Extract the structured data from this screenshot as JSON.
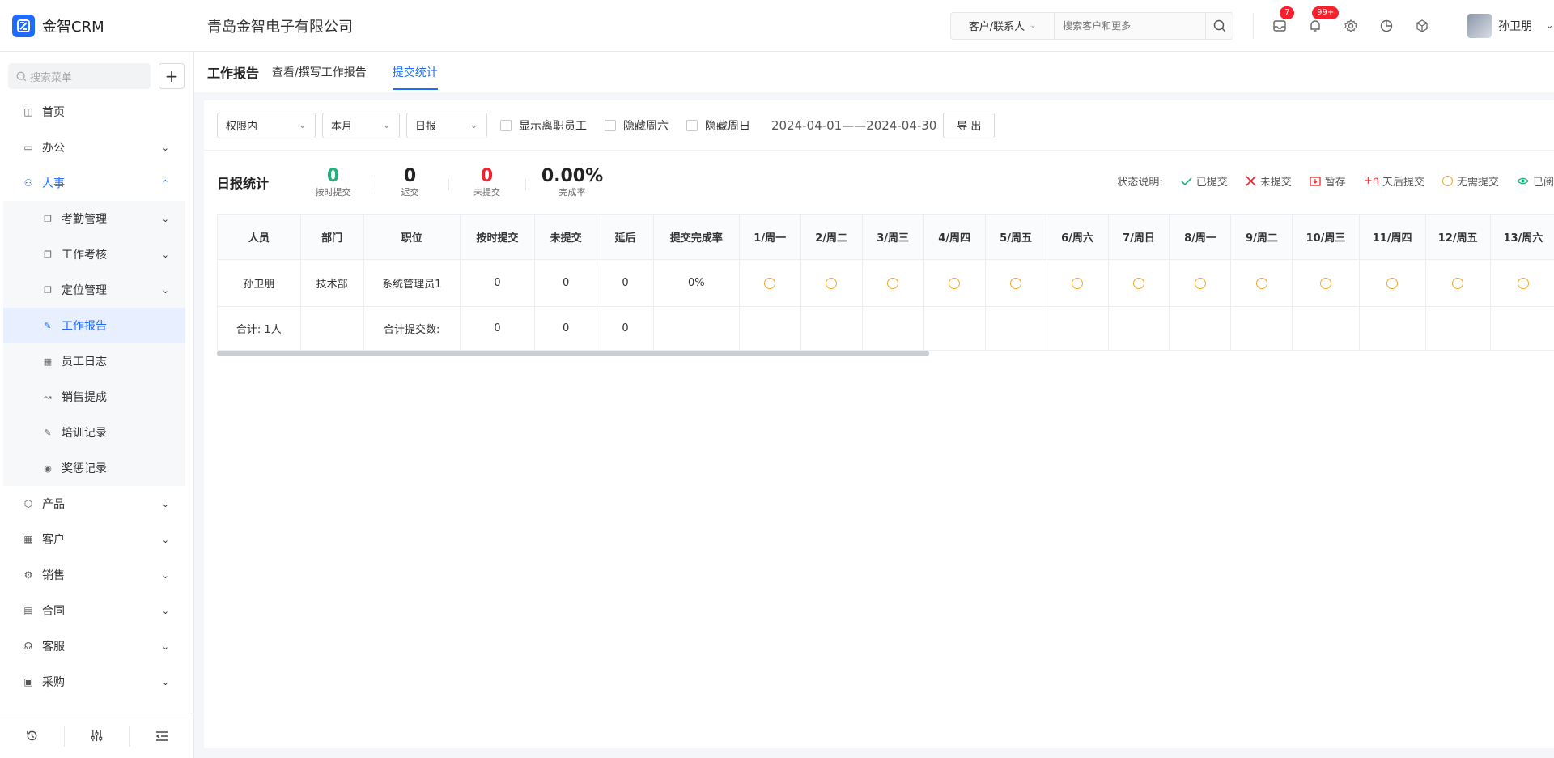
{
  "header": {
    "brand": "金智CRM",
    "company": "青岛金智电子有限公司",
    "search_scope": "客户/联系人",
    "search_placeholder": "搜索客户和更多",
    "messages_badge": "7",
    "notifications_badge": "99+",
    "user_name": "孙卫朋"
  },
  "sidebar": {
    "search_placeholder": "搜索菜单",
    "items": {
      "home": "首页",
      "office": "办公",
      "hr": "人事",
      "product": "产品",
      "customer": "客户",
      "sales": "销售",
      "contract": "合同",
      "service": "客服",
      "purchase": "采购"
    },
    "hr_sub": {
      "attendance": "考勤管理",
      "assessment": "工作考核",
      "location": "定位管理",
      "work_report": "工作报告",
      "staff_log": "员工日志",
      "commission": "销售提成",
      "training": "培训记录",
      "reward": "奖惩记录"
    }
  },
  "page": {
    "title": "工作报告",
    "tabs": [
      "查看/撰写工作报告",
      "提交统计"
    ]
  },
  "filters": {
    "scope": "权限内",
    "period": "本月",
    "report_type": "日报",
    "show_resigned": "显示离职员工",
    "hide_saturday": "隐藏周六",
    "hide_sunday": "隐藏周日",
    "date_range": "2024-04-01——2024-04-30",
    "export": "导 出"
  },
  "stats": {
    "title": "日报统计",
    "on_time": {
      "value": "0",
      "label": "按时提交"
    },
    "late": {
      "value": "0",
      "label": "迟交"
    },
    "not_submitted": {
      "value": "0",
      "label": "未提交"
    },
    "completion": {
      "value": "0.00%",
      "label": "完成率"
    }
  },
  "legend": {
    "label": "状态说明:",
    "submitted": "已提交",
    "not_submitted": "未提交",
    "draft": "暂存",
    "n_days_prefix": "+n",
    "n_days": "天后提交",
    "not_required": "无需提交",
    "read": "已阅"
  },
  "table": {
    "headers": [
      "人员",
      "部门",
      "职位",
      "按时提交",
      "未提交",
      "延后",
      "提交完成率",
      "1/周一",
      "2/周二",
      "3/周三",
      "4/周四",
      "5/周五",
      "6/周六",
      "7/周日",
      "8/周一",
      "9/周二",
      "10/周三",
      "11/周四",
      "12/周五",
      "13/周六"
    ],
    "row": [
      "孙卫朋",
      "技术部",
      "系统管理员1",
      "0",
      "0",
      "0",
      "0%"
    ],
    "total": {
      "label": "合计:  1人",
      "sum_label": "合计提交数:",
      "values": [
        "0",
        "0",
        "0"
      ]
    }
  },
  "colors": {
    "accent": "#1f6bff",
    "green": "#22b07d",
    "red": "#f5222d",
    "orange": "#f5a623"
  }
}
